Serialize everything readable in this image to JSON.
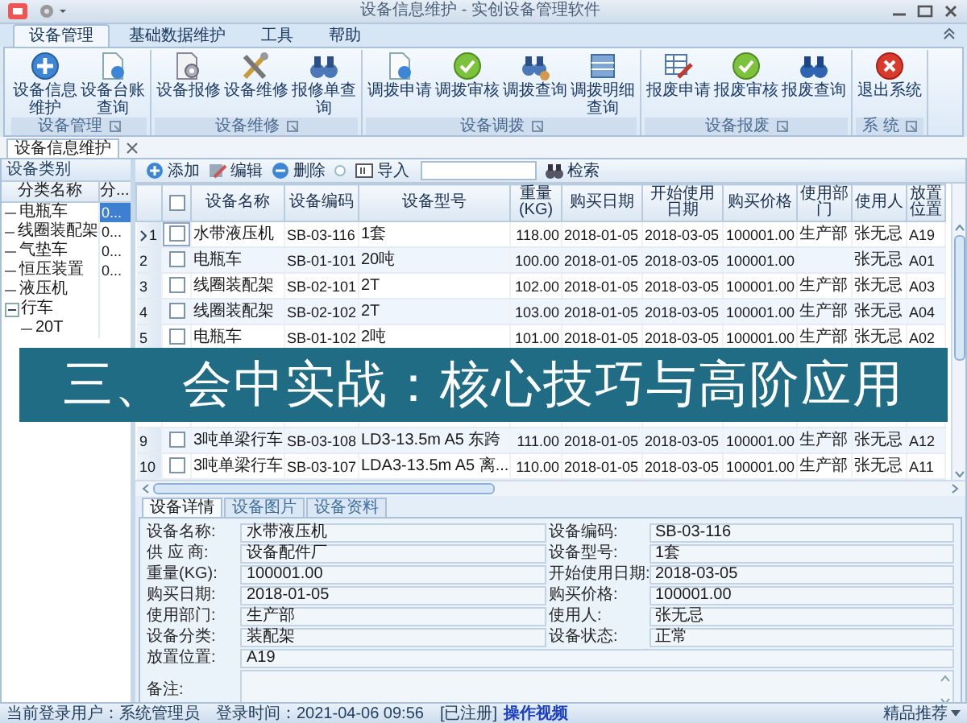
{
  "window": {
    "title": "设备信息维护 - 实创设备管理软件"
  },
  "ribbon": {
    "tabs": [
      {
        "label": "设备管理",
        "selected": true
      },
      {
        "label": "基础数据维护",
        "selected": false
      },
      {
        "label": "工具",
        "selected": false
      },
      {
        "label": "帮助",
        "selected": false
      }
    ],
    "groups": [
      {
        "label": "设备管理",
        "buttons": [
          "设备信息维护",
          "设备台账查询"
        ]
      },
      {
        "label": "设备维修",
        "buttons": [
          "设备报修",
          "设备维修",
          "报修单查询"
        ]
      },
      {
        "label": "设备调拨",
        "buttons": [
          "调拨申请",
          "调拨审核",
          "调拨查询",
          "调拨明细查询"
        ]
      },
      {
        "label": "设备报废",
        "buttons": [
          "报废申请",
          "报废审核",
          "报废查询"
        ]
      },
      {
        "label": "系 统",
        "buttons": [
          "退出系统"
        ]
      }
    ]
  },
  "document_tabs": [
    {
      "label": "设备信息维护",
      "selected": true
    }
  ],
  "category_panel": {
    "title": "设备类别",
    "columns": [
      "分类名称",
      "分..."
    ],
    "tree": [
      {
        "label": "电瓶车",
        "value": "0...",
        "selected": true
      },
      {
        "label": "线圈装配架",
        "value": "0...",
        "selected": false
      },
      {
        "label": "气垫车",
        "value": "0...",
        "selected": false
      },
      {
        "label": "恒压装置",
        "value": "0...",
        "selected": false
      },
      {
        "label": "液压机",
        "selected": false
      },
      {
        "label": "行车",
        "selected": false,
        "expanded": true,
        "children": [
          {
            "label": "20T",
            "selected": false
          }
        ]
      }
    ]
  },
  "toolbar": {
    "buttons": [
      "添加",
      "编辑",
      "删除",
      "导入"
    ],
    "search_button": "检索"
  },
  "grid": {
    "all_checked": false,
    "columns": [
      "设备名称",
      "设备编码",
      "设备型号",
      "重量(KG)",
      "购买日期",
      "开始使用日期",
      "购买价格",
      "使用部门",
      "使用人",
      "放置位置"
    ],
    "rows": [
      {
        "number": "1",
        "selected": true,
        "checked": false,
        "name": "水带液压机",
        "code": "SB-03-116",
        "model": "1套",
        "weight": "118.00",
        "buy_date": "2018-01-05",
        "start_date": "2018-03-05",
        "price": "100001.00",
        "department": "生产部",
        "user": "张无忌",
        "location": "A19"
      },
      {
        "number": "2",
        "selected": false,
        "checked": false,
        "name": "电瓶车",
        "code": "SB-01-101",
        "model": "20吨",
        "weight": "100.00",
        "buy_date": "2018-01-05",
        "start_date": "2018-03-05",
        "price": "100001.00",
        "user": "张无忌",
        "location": "A01"
      },
      {
        "number": "3",
        "selected": false,
        "checked": false,
        "name": "线圈装配架",
        "code": "SB-02-101",
        "model": "2T",
        "weight": "102.00",
        "buy_date": "2018-01-05",
        "start_date": "2018-03-05",
        "price": "100001.00",
        "department": "生产部",
        "user": "张无忌",
        "location": "A03"
      },
      {
        "number": "4",
        "selected": false,
        "checked": false,
        "name": "线圈装配架",
        "code": "SB-02-102",
        "model": "2T",
        "weight": "103.00",
        "buy_date": "2018-01-05",
        "start_date": "2018-03-05",
        "price": "100001.00",
        "department": "生产部",
        "user": "张无忌",
        "location": "A04"
      },
      {
        "number": "5",
        "selected": false,
        "checked": false,
        "name": "电瓶车",
        "code": "SB-01-102",
        "model": "2吨",
        "weight": "101.00",
        "buy_date": "2018-01-05",
        "start_date": "2018-03-05",
        "price": "100001.00",
        "department": "生产部",
        "user": "张无忌",
        "location": "A02"
      },
      {
        "number": "9",
        "selected": false,
        "checked": false,
        "name": "3吨单梁行车",
        "code": "SB-03-108",
        "model": "LD3-13.5m A5 东跨",
        "weight": "111.00",
        "buy_date": "2018-01-05",
        "start_date": "2018-03-05",
        "price": "100001.00",
        "department": "生产部",
        "user": "张无忌",
        "location": "A12"
      },
      {
        "number": "10",
        "selected": false,
        "checked": false,
        "name": "3吨单梁行车",
        "code": "SB-03-107",
        "model": "LDA3-13.5m A5 离...",
        "weight": "110.00",
        "buy_date": "2018-01-05",
        "start_date": "2018-03-05",
        "price": "100001.00",
        "department": "生产部",
        "user": "张无忌",
        "location": "A11"
      }
    ]
  },
  "detail_tabs": [
    {
      "label": "设备详情",
      "selected": true
    },
    {
      "label": "设备图片",
      "selected": false
    },
    {
      "label": "设备资料",
      "selected": false
    }
  ],
  "detail_fields": [
    {
      "kind": "half",
      "label": "设备名称:",
      "value": "水带液压机"
    },
    {
      "kind": "half",
      "label": "设备编码:",
      "value": "SB-03-116"
    },
    {
      "kind": "half",
      "label": "供 应 商:",
      "value": "设备配件厂"
    },
    {
      "kind": "half",
      "label": "设备型号:",
      "value": "1套"
    },
    {
      "kind": "half",
      "label": "重量(KG):",
      "value": "100001.00"
    },
    {
      "kind": "half",
      "label": "开始使用日期:",
      "value": "2018-03-05"
    },
    {
      "kind": "half",
      "label": "购买日期:",
      "value": "2018-01-05"
    },
    {
      "kind": "half",
      "label": "购买价格:",
      "value": "100001.00"
    },
    {
      "kind": "half",
      "label": "使用部门:",
      "value": "生产部"
    },
    {
      "kind": "half",
      "label": "使用人:",
      "value": "张无忌"
    },
    {
      "kind": "half",
      "label": "设备分类:",
      "value": "装配架"
    },
    {
      "kind": "half",
      "label": "设备状态:",
      "value": "正常"
    },
    {
      "kind": "full",
      "label": "放置位置:",
      "value": "A19"
    },
    {
      "kind": "memo",
      "label": "备注:"
    }
  ],
  "status_bar": {
    "user": "当前登录用户：系统管理员",
    "login_time": "登录时间：2021-04-06 09:56",
    "registered": "[已注册]",
    "video_link": "操作视频",
    "recommend": "精品推荐"
  },
  "banner": {
    "text": "三、 会中实战：核心技巧与高阶应用"
  }
}
